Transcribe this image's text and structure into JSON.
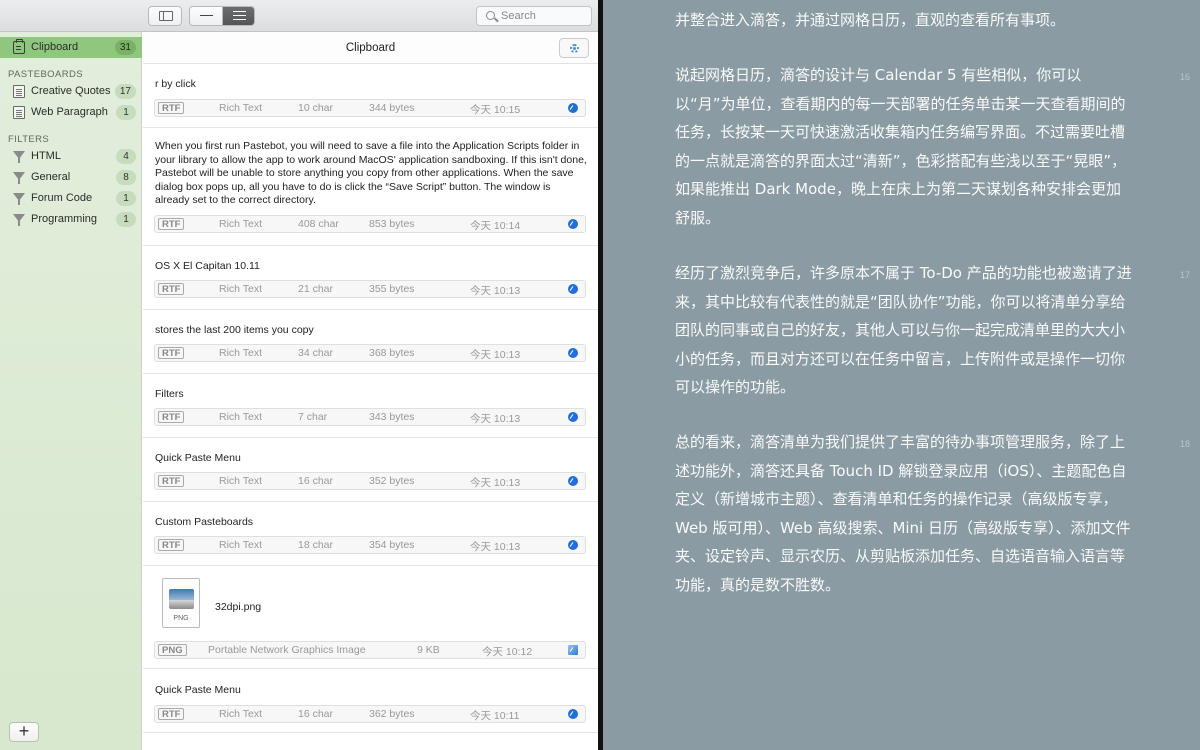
{
  "toolbar": {
    "search_placeholder": "Search"
  },
  "sidebar": {
    "clipboard": {
      "label": "Clipboard",
      "count": "31"
    },
    "pasteboards_header": "PASTEBOARDS",
    "pasteboards": [
      {
        "label": "Creative Quotes",
        "count": "17",
        "icon": "document-icon"
      },
      {
        "label": "Web Paragraph",
        "count": "1",
        "icon": "document-icon"
      }
    ],
    "filters_header": "FILTERS",
    "filters": [
      {
        "label": "HTML",
        "count": "4",
        "icon": "filter-icon"
      },
      {
        "label": "General",
        "count": "8",
        "icon": "filter-icon"
      },
      {
        "label": "Forum Code",
        "count": "1",
        "icon": "filter-icon"
      },
      {
        "label": "Programming",
        "count": "1",
        "icon": "filter-icon"
      }
    ],
    "add_label": "+"
  },
  "main": {
    "title": "Clipboard",
    "items": [
      {
        "text": "r by click",
        "type": "RTF",
        "kind": "Rich Text",
        "chars": "10 char",
        "bytes": "344 bytes",
        "time": "今天 10:15"
      },
      {
        "text": "When you first run Pastebot, you will need to save a file into the Application Scripts folder in your library to allow the app to work around MacOS' application sandboxing. If this isn't done, Pastebot will be unable to store anything you copy from other applications. When the save dialog box pops up, all you have to do is click the “Save Script” button. The window is already set to the correct directory.",
        "type": "RTF",
        "kind": "Rich Text",
        "chars": "408 char",
        "bytes": "853 bytes",
        "time": "今天 10:14"
      },
      {
        "text": "OS X El Capitan 10.11",
        "type": "RTF",
        "kind": "Rich Text",
        "chars": "21 char",
        "bytes": "355 bytes",
        "time": "今天 10:13"
      },
      {
        "text": "stores the last 200 items you copy",
        "type": "RTF",
        "kind": "Rich Text",
        "chars": "34 char",
        "bytes": "368 bytes",
        "time": "今天 10:13"
      },
      {
        "text": "Filters",
        "type": "RTF",
        "kind": "Rich Text",
        "chars": "7 char",
        "bytes": "343 bytes",
        "time": "今天 10:13"
      },
      {
        "text": "Quick Paste Menu",
        "type": "RTF",
        "kind": "Rich Text",
        "chars": "16 char",
        "bytes": "352 bytes",
        "time": "今天 10:13"
      },
      {
        "text": "Custom Pasteboards",
        "type": "RTF",
        "kind": "Rich Text",
        "chars": "18 char",
        "bytes": "354 bytes",
        "time": "今天 10:13"
      },
      {
        "text": "32dpi.png",
        "icon_label": "PNG",
        "type": "PNG",
        "kind": "Portable Network Graphics Image",
        "chars": "9 KB",
        "bytes": "",
        "time": "今天 10:12"
      },
      {
        "text": "Quick Paste Menu",
        "type": "RTF",
        "kind": "Rich Text",
        "chars": "16 char",
        "bytes": "362 bytes",
        "time": "今天 10:11"
      }
    ]
  },
  "reader": {
    "paragraphs": [
      {
        "text": "并整合进入滴答，并通过网格日历，直观的查看所有事项。",
        "number": ""
      },
      {
        "text": "说起网格日历，滴答的设计与 Calendar 5 有些相似，你可以以“月”为单位，查看期内的每一天部署的任务单击某一天查看期间的任务，长按某一天可快速激活收集箱内任务编写界面。不过需要吐槽的一点就是滴答的界面太过“清新”，色彩搭配有些浅以至于“晃眼”，如果能推出 Dark Mode，晚上在床上为第二天谋划各种安排会更加舒服。",
        "number": "16"
      },
      {
        "text": "经历了激烈竞争后，许多原本不属于 To-Do 产品的功能也被邀请了进来，其中比较有代表性的就是“团队协作”功能，你可以将清单分享给团队的同事或自己的好友，其他人可以与你一起完成清单里的大大小小的任务，而且对方还可以在任务中留言，上传附件或是操作一切你可以操作的功能。",
        "number": "17"
      },
      {
        "text": "总的看来，滴答清单为我们提供了丰富的待办事项管理服务，除了上述功能外，滴答还具备 Touch ID 解锁登录应用（iOS）、主题配色自定义（新增城市主题）、查看清单和任务的操作记录（高级版专享，Web 版可用）、Web 高级搜索、Mini 日历（高级版专享）、添加文件夹、设定铃声、显示农历、从剪贴板添加任务、自选语音输入语言等功能，真的是数不胜数。",
        "number": "18"
      }
    ]
  }
}
